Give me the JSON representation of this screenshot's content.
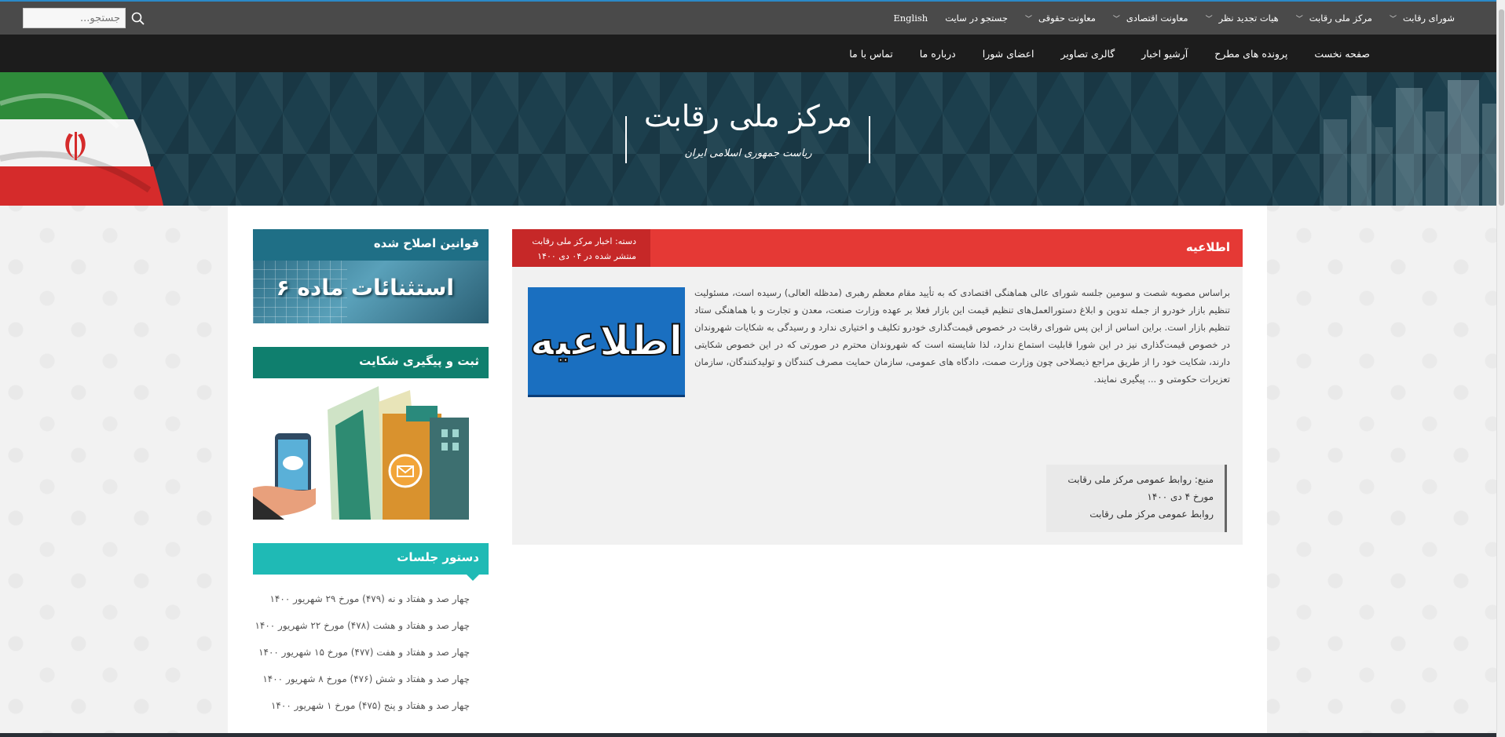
{
  "search": {
    "placeholder": "جستجو..."
  },
  "top_menu": [
    {
      "label": "شورای رقابت",
      "dropdown": true
    },
    {
      "label": "مرکز ملی رقابت",
      "dropdown": true
    },
    {
      "label": "هیات تجدید نظر",
      "dropdown": true
    },
    {
      "label": "معاونت اقتصادی",
      "dropdown": true
    },
    {
      "label": "معاونت حقوقی",
      "dropdown": true
    },
    {
      "label": "جستجو در سایت",
      "dropdown": false
    },
    {
      "label": "English",
      "dropdown": false
    }
  ],
  "main_menu": [
    "صفحه نخست",
    "پرونده های مطرح",
    "آرشیو اخبار",
    "گالری تصاویر",
    "اعضای شورا",
    "درباره ما",
    "تماس با ما"
  ],
  "banner": {
    "title": "مرکز ملی رقابت",
    "subtitle": "ریاست جمهوری اسلامی ایران"
  },
  "article": {
    "title": "اطلاعیه",
    "category": "دسته: اخبار مرکز ملی رقابت",
    "published": "منتشر شده در ۰۴ دی ۱۴۰۰",
    "image_text": "اطلاعیه",
    "body": "براساس مصوبه شصت و سومین جلسه شورای عالی هماهنگی اقتصادی که به تأیید مقام معظم رهبری (مدظله العالی) رسیده است، مسئولیت تنظیم بازار خودرو از جمله تدوین و ابلاغ دستورالعمل‌های تنظیم قیمت این بازار فعلا بر عهده وزارت صنعت، معدن و تجارت و با هماهنگی ستاد تنظیم بازار است. براین اساس از این پس شورای رقابت در خصوص قیمت‌گذاری خودرو تکلیف و اختیاری ندارد و رسیدگی به شکایات شهروندان در خصوص قیمت‌گذاری نیز در این شورا قابلیت استماع ندارد، لذا شایسته است که شهروندان محترم در صورتی که در این خصوص شکایتی دارند، شکایت خود را از طریق مراجع ذیصلاحی چون وزارت صمت، دادگاه های عمومی، سازمان حمایت مصرف کنندگان و تولیدکنندگان، سازمان تعزیرات حکومتی و ... پیگیری نمایند.",
    "source_lines": [
      "منبع: روابط عمومی مرکز ملی رقابت",
      "مورخ ۴ دی ۱۴۰۰",
      "روابط عمومی مرکز ملی رقابت"
    ]
  },
  "sidebar": {
    "laws": {
      "title": "قوانین اصلاح شده",
      "image_text": "استثنائات ماده ۶",
      "color": "#1f6f86"
    },
    "complaint": {
      "title": "ثبت و پیگیری شکایت",
      "color": "#0f7f6e"
    },
    "agenda": {
      "title": "دستور جلسات",
      "color": "#1fbab5",
      "items": [
        "چهار صد و هفتاد و نه (۴۷۹) مورخ ۲۹ شهریور ۱۴۰۰",
        "چهار صد و هفتاد و هشت (۴۷۸) مورخ ۲۲ شهریور ۱۴۰۰",
        "چهار صد و هفتاد و هفت (۴۷۷) مورخ ۱۵ شهریور ۱۴۰۰",
        "چهار صد و هفتاد و شش (۴۷۶) مورخ ۸ شهریور ۱۴۰۰",
        "چهار صد و هفتاد و پنج (۴۷۵) مورخ ۱ شهریور ۱۴۰۰"
      ]
    }
  },
  "colors": {
    "topbar": "#4a4a4a",
    "mainnav": "#1c1c1c",
    "article_header": "#e53935",
    "article_meta": "#c62828"
  }
}
